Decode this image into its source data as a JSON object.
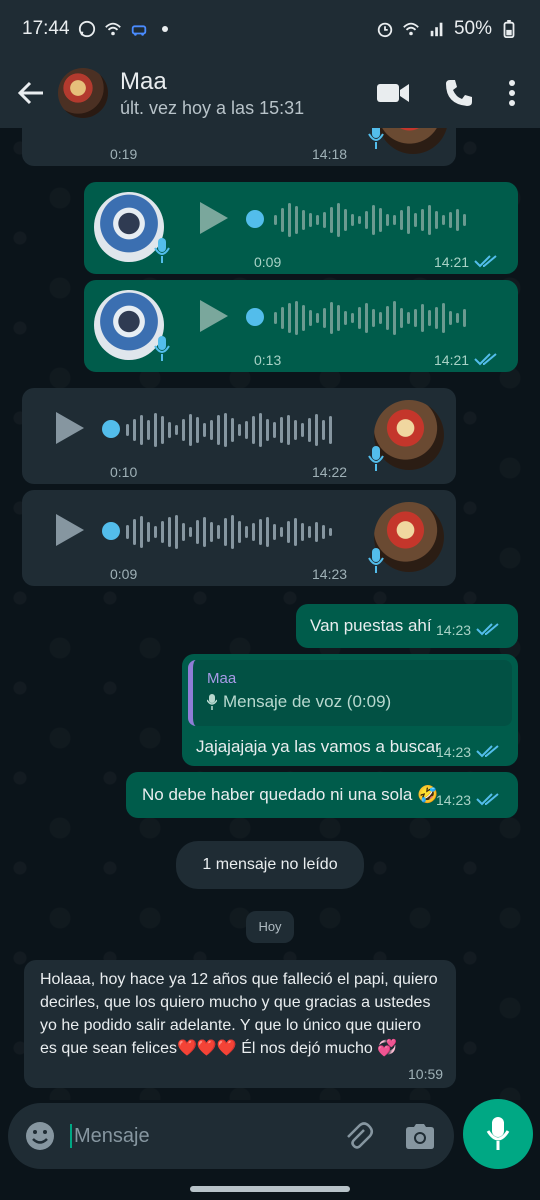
{
  "status_bar": {
    "time": "17:44",
    "battery": "50%",
    "left_icons": [
      "whatsapp-icon",
      "wifi-icon",
      "car-icon"
    ],
    "right_icons": [
      "alarm-icon",
      "wifi-icon",
      "signal-icon",
      "battery-icon"
    ]
  },
  "header": {
    "contact_name": "Maa",
    "last_seen": "últ. vez hoy a las 15:31",
    "icons": [
      "back-arrow-icon",
      "video-call-icon",
      "phone-icon",
      "more-vert-icon"
    ]
  },
  "messages": [
    {
      "type": "voice",
      "direction": "in",
      "duration": "0:19",
      "time": "14:18"
    },
    {
      "type": "voice",
      "direction": "out",
      "duration": "0:09",
      "time": "14:21",
      "ticks": "read"
    },
    {
      "type": "voice",
      "direction": "out",
      "duration": "0:13",
      "time": "14:21",
      "ticks": "read"
    },
    {
      "type": "voice",
      "direction": "in",
      "duration": "0:10",
      "time": "14:22"
    },
    {
      "type": "voice",
      "direction": "in",
      "duration": "0:09",
      "time": "14:23"
    },
    {
      "type": "text",
      "direction": "out",
      "text": "Van puestas ahí",
      "time": "14:23",
      "ticks": "read"
    },
    {
      "type": "reply",
      "direction": "out",
      "quote_author": "Maa",
      "quote_text": "Mensaje de voz (0:09)",
      "text": "Jajajajaja ya las vamos a buscar",
      "time": "14:23",
      "ticks": "read"
    },
    {
      "type": "text",
      "direction": "out",
      "text": "No debe haber quedado ni una sola 🤣",
      "time": "14:23",
      "ticks": "read"
    },
    {
      "type": "unread",
      "text": "1 mensaje no leído"
    },
    {
      "type": "date",
      "text": "Hoy"
    },
    {
      "type": "text",
      "direction": "in",
      "lines": [
        "Holaaa, hoy hace ya 12 años que falleció el papi, quiero",
        "decirles, que los quiero mucho y que gracias a ustedes",
        "yo he podido salir adelante. Y que lo único que quiero",
        "es que sean felices❤️❤️❤️ Él nos dejó mucho 💞"
      ],
      "time": "10:59"
    }
  ],
  "composer": {
    "placeholder": "Mensaje",
    "icons": [
      "emoji-icon",
      "attach-icon",
      "camera-icon",
      "mic-icon"
    ]
  },
  "colors": {
    "incoming": "#1f2c34",
    "outgoing": "#005c4b",
    "accent": "#00a884",
    "read_ticks": "#53bdeb"
  }
}
